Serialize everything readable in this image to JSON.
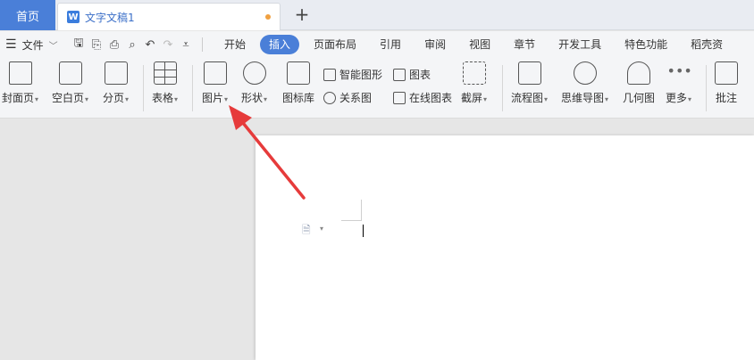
{
  "tabs": {
    "home": "首页",
    "document": "文字文稿1",
    "new_tab": "+"
  },
  "menubar": {
    "file": "文件",
    "tabs": [
      "开始",
      "插入",
      "页面布局",
      "引用",
      "审阅",
      "视图",
      "章节",
      "开发工具",
      "特色功能",
      "稻壳资"
    ],
    "active_tab": "插入"
  },
  "ribbon": {
    "cover": "封面页",
    "blank": "空白页",
    "page_break": "分页",
    "table": "表格",
    "picture": "图片",
    "shape": "形状",
    "icon_lib": "图标库",
    "smart_art": "智能图形",
    "chart": "图表",
    "relation": "关系图",
    "online_chart": "在线图表",
    "screenshot": "截屏",
    "flowchart": "流程图",
    "mindmap": "思维导图",
    "geometry": "几何图",
    "more": "更多",
    "comment": "批注"
  },
  "colors": {
    "accent": "#4a7fd8",
    "arrow": "#e63b3b"
  }
}
